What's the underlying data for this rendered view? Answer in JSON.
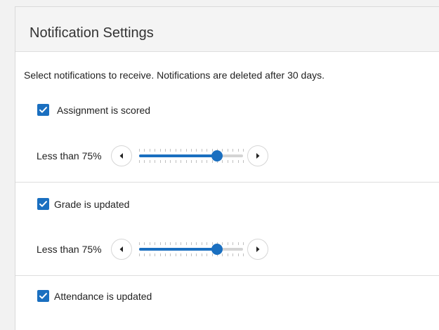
{
  "panel": {
    "title": "Notification Settings",
    "intro": "Select notifications to receive. Notifications are deleted after 30 days."
  },
  "notifications": [
    {
      "label": "Assignment is scored",
      "checked": true,
      "threshold": {
        "label": "Less than 75%",
        "value_percent": 75
      }
    },
    {
      "label": "Grade is updated",
      "checked": true,
      "threshold": {
        "label": "Less than 75%",
        "value_percent": 75
      }
    },
    {
      "label": "Attendance is updated",
      "checked": true
    }
  ],
  "colors": {
    "accent": "#1a6fc0",
    "header_bg": "#f4f4f4",
    "track": "#d4d4d4"
  },
  "icons": {
    "checkbox": "checkmark-icon",
    "decrease": "caret-left-icon",
    "increase": "caret-right-icon"
  }
}
